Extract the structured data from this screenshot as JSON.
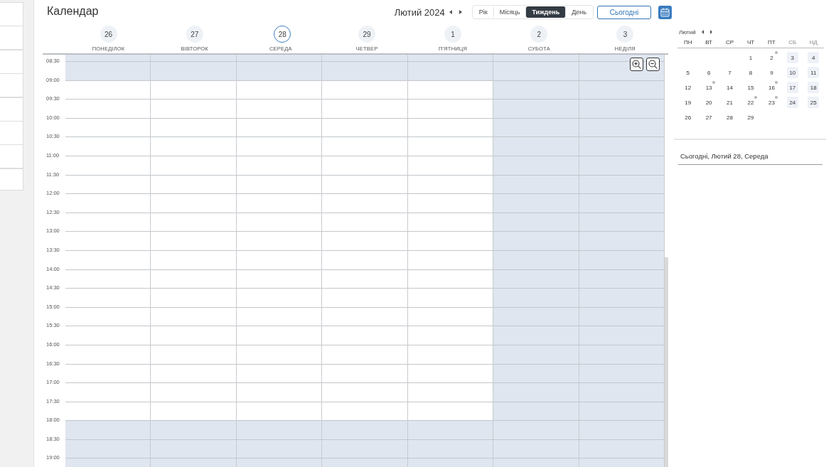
{
  "header": {
    "title": "Календар",
    "period": "Лютий 2024",
    "views": [
      {
        "label": "Рік",
        "selected": false
      },
      {
        "label": "Місяць",
        "selected": false
      },
      {
        "label": "Тиждень",
        "selected": true
      },
      {
        "label": "День",
        "selected": false
      }
    ],
    "today_button": "Сьогодні"
  },
  "days": [
    {
      "number": "26",
      "name": "ПОНЕДІЛОК",
      "today": false,
      "weekend": false
    },
    {
      "number": "27",
      "name": "ВІВТОРОК",
      "today": false,
      "weekend": false
    },
    {
      "number": "28",
      "name": "СЕРЕДА",
      "today": true,
      "weekend": false
    },
    {
      "number": "29",
      "name": "ЧЕТВЕР",
      "today": false,
      "weekend": false
    },
    {
      "number": "1",
      "name": "П'ЯТНИЦЯ",
      "today": false,
      "weekend": false
    },
    {
      "number": "2",
      "name": "СУБОТА",
      "today": false,
      "weekend": true
    },
    {
      "number": "3",
      "name": "НЕДІЛЯ",
      "today": false,
      "weekend": true
    }
  ],
  "time_slots": [
    {
      "time": "08:30",
      "off_hours": true
    },
    {
      "time": "09:00",
      "off_hours": false
    },
    {
      "time": "09:30",
      "off_hours": false
    },
    {
      "time": "10:00",
      "off_hours": false
    },
    {
      "time": "10:30",
      "off_hours": false
    },
    {
      "time": "11:00",
      "off_hours": false
    },
    {
      "time": "11:30",
      "off_hours": false
    },
    {
      "time": "12:00",
      "off_hours": false
    },
    {
      "time": "12:30",
      "off_hours": false
    },
    {
      "time": "13:00",
      "off_hours": false
    },
    {
      "time": "13:30",
      "off_hours": false
    },
    {
      "time": "14:00",
      "off_hours": false
    },
    {
      "time": "14:30",
      "off_hours": false
    },
    {
      "time": "15:00",
      "off_hours": false
    },
    {
      "time": "15:30",
      "off_hours": false
    },
    {
      "time": "16:00",
      "off_hours": false
    },
    {
      "time": "16:30",
      "off_hours": false
    },
    {
      "time": "17:00",
      "off_hours": false
    },
    {
      "time": "17:30",
      "off_hours": false
    },
    {
      "time": "18:00",
      "off_hours": true
    },
    {
      "time": "18:30",
      "off_hours": true
    },
    {
      "time": "19:00",
      "off_hours": true
    }
  ],
  "mini_calendar": {
    "month": "Лютий",
    "weekdays": [
      {
        "label": "ПН",
        "weekend": false
      },
      {
        "label": "ВТ",
        "weekend": false
      },
      {
        "label": "СР",
        "weekend": false
      },
      {
        "label": "ЧТ",
        "weekend": false
      },
      {
        "label": "ПТ",
        "weekend": false
      },
      {
        "label": "СБ",
        "weekend": true
      },
      {
        "label": "НД",
        "weekend": true
      }
    ],
    "weeks": [
      {
        "kind": "first",
        "days": [
          {
            "day": "1",
            "weekend": false,
            "event": false
          },
          {
            "day": "2",
            "weekend": false,
            "event": true
          },
          {
            "day": "3",
            "weekend": true,
            "event": false
          },
          {
            "day": "4",
            "weekend": true,
            "event": false
          }
        ]
      },
      {
        "kind": "full",
        "days": [
          {
            "day": "5",
            "weekend": false,
            "event": false
          },
          {
            "day": "6",
            "weekend": false,
            "event": false
          },
          {
            "day": "7",
            "weekend": false,
            "event": false
          },
          {
            "day": "8",
            "weekend": false,
            "event": false
          },
          {
            "day": "9",
            "weekend": false,
            "event": false
          },
          {
            "day": "10",
            "weekend": true,
            "event": false
          },
          {
            "day": "11",
            "weekend": true,
            "event": false
          }
        ]
      },
      {
        "kind": "full",
        "days": [
          {
            "day": "12",
            "weekend": false,
            "event": false
          },
          {
            "day": "13",
            "weekend": false,
            "event": true
          },
          {
            "day": "14",
            "weekend": false,
            "event": false
          },
          {
            "day": "15",
            "weekend": false,
            "event": false
          },
          {
            "day": "16",
            "weekend": false,
            "event": true
          },
          {
            "day": "17",
            "weekend": true,
            "event": false
          },
          {
            "day": "18",
            "weekend": true,
            "event": false
          }
        ]
      },
      {
        "kind": "full",
        "days": [
          {
            "day": "19",
            "weekend": false,
            "event": false
          },
          {
            "day": "20",
            "weekend": false,
            "event": false
          },
          {
            "day": "21",
            "weekend": false,
            "event": false
          },
          {
            "day": "22",
            "weekend": false,
            "event": true
          },
          {
            "day": "23",
            "weekend": false,
            "event": true
          },
          {
            "day": "24",
            "weekend": true,
            "event": false
          },
          {
            "day": "25",
            "weekend": true,
            "event": false
          }
        ]
      },
      {
        "kind": "last",
        "days": [
          {
            "day": "26",
            "weekend": false,
            "event": false
          },
          {
            "day": "27",
            "weekend": false,
            "event": false
          },
          {
            "day": "28",
            "weekend": false,
            "event": false
          },
          {
            "day": "29",
            "weekend": false,
            "event": false
          }
        ]
      }
    ]
  },
  "agenda": {
    "heading": "Сьогодні, Лютий 28, Середа"
  }
}
